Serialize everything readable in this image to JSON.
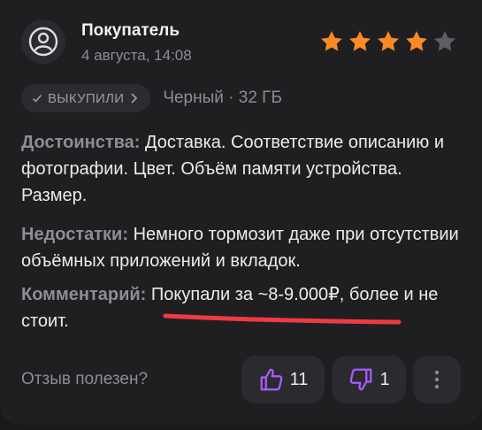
{
  "review": {
    "author": "Покупатель",
    "date": "4 августа, 14:08",
    "rating": 4,
    "rating_max": 5,
    "badge_label": "ВЫКУПИЛИ",
    "variant": "Черный · 32 ГБ",
    "pros_label": "Достоинства:",
    "pros_text": " Доставка. Соответствие описанию и фотографии. Цвет. Объём памяти устройства. Размер.",
    "cons_label": "Недостатки:",
    "cons_text": " Немного тормозит даже при отсутствии объёмных приложений и вкладок.",
    "comment_label": "Комментарий:",
    "comment_text": " Покупали за ~8-9.000₽, более и не стоит."
  },
  "footer": {
    "helpful_label": "Отзыв полезен?",
    "likes": "11",
    "dislikes": "1"
  },
  "colors": {
    "star_filled": "#f98a25",
    "star_empty": "#5e5e62",
    "thumb_icon": "#a85dff",
    "underline": "#f03a43"
  },
  "icons": {
    "avatar": "user-circle-icon",
    "badge": "check-icon",
    "badge_more": "chevron-right-icon",
    "like": "thumbs-up-icon",
    "dislike": "thumbs-down-icon",
    "more": "more-vertical-icon"
  }
}
